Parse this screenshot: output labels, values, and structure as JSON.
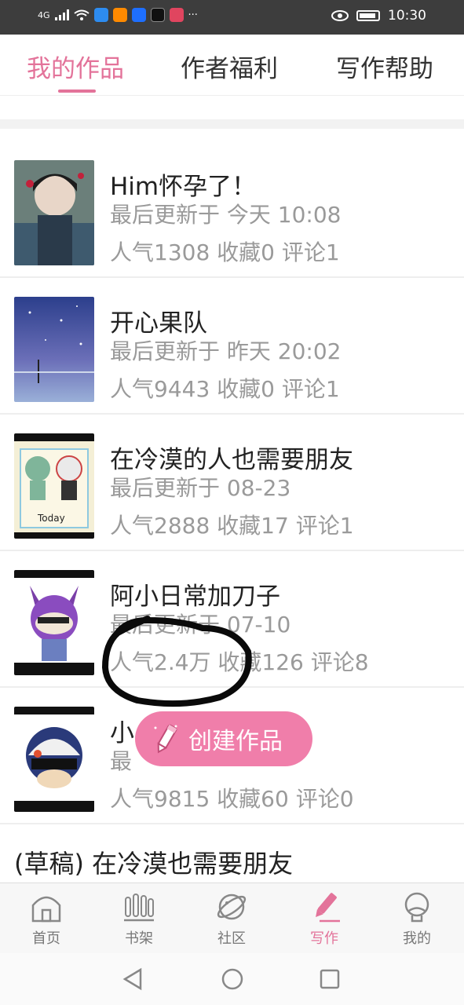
{
  "status_bar": {
    "signal": "4G",
    "time": "10:30"
  },
  "tabs": [
    {
      "label": "我的作品",
      "active": true
    },
    {
      "label": "作者福利",
      "active": false
    },
    {
      "label": "写作帮助",
      "active": false
    }
  ],
  "works": [
    {
      "title": "Him怀孕了！",
      "updated": "最后更新于 今天 10:08",
      "stats": "人气1308 收藏0 评论1"
    },
    {
      "title": "开心果队",
      "updated": "最后更新于 昨天 20:02",
      "stats": "人气9443 收藏0 评论1"
    },
    {
      "title": "在冷漠的人也需要朋友",
      "updated": "最后更新于 08-23",
      "stats": "人气2888 收藏17 评论1"
    },
    {
      "title": "阿小日常加刀子",
      "updated": "最后更新于 07-10",
      "stats": "人气2.4万 收藏126 评论8"
    },
    {
      "title": "小",
      "updated": "最",
      "stats": "人气9815 收藏60 评论0"
    }
  ],
  "draft": {
    "label": "(草稿) 在冷漠也需要朋友"
  },
  "fab": {
    "label": "创建作品"
  },
  "bottom_nav": [
    {
      "label": "首页",
      "icon": "home-icon",
      "active": false
    },
    {
      "label": "书架",
      "icon": "bookshelf-icon",
      "active": false
    },
    {
      "label": "社区",
      "icon": "planet-icon",
      "active": false
    },
    {
      "label": "写作",
      "icon": "pen-icon",
      "active": true
    },
    {
      "label": "我的",
      "icon": "profile-icon",
      "active": false
    }
  ],
  "colors": {
    "accent": "#e3739a",
    "fab": "#f07eaa",
    "muted": "#9a9a9a"
  }
}
